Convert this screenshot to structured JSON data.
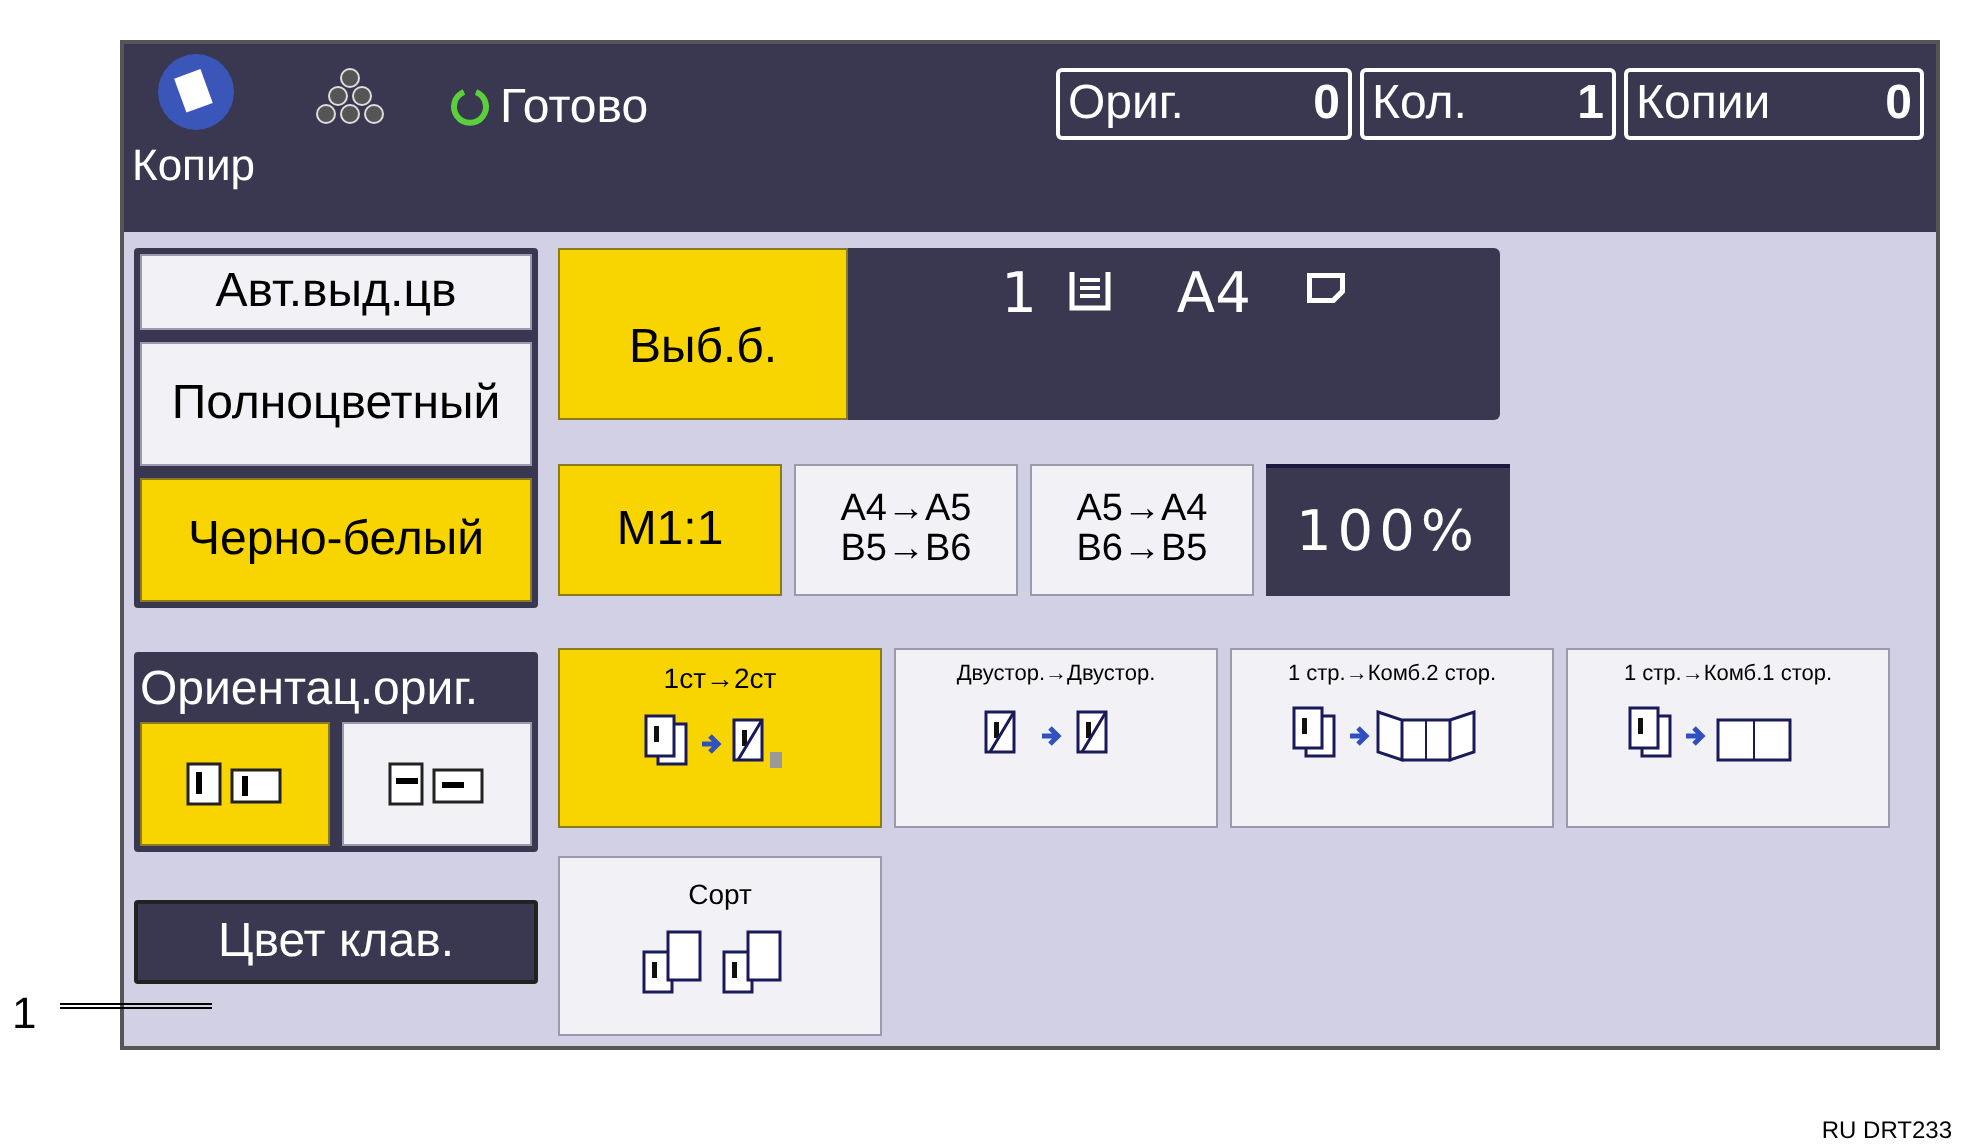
{
  "header": {
    "app_label": "Копир",
    "status": "Готово",
    "counters": [
      {
        "label": "Ориг.",
        "value": "0"
      },
      {
        "label": "Кол.",
        "value": "1"
      },
      {
        "label": "Копии",
        "value": "0"
      }
    ]
  },
  "color_modes": [
    {
      "label": "Авт.выд.цв",
      "selected": false
    },
    {
      "label": "Полноцветный",
      "selected": false
    },
    {
      "label": "Черно-белый",
      "selected": true
    }
  ],
  "orientation": {
    "title": "Ориентац.ориг.",
    "options": [
      {
        "kind": "upright",
        "selected": true
      },
      {
        "kind": "rotated",
        "selected": false
      }
    ]
  },
  "color_key_button": "Цвет клав.",
  "paper": {
    "button": {
      "label": "Выб.б.",
      "selected": true
    },
    "tray": "1",
    "size": "A4"
  },
  "ratio_buttons": [
    {
      "lines": [
        "M1:1"
      ],
      "selected": true
    },
    {
      "lines": [
        "A4→A5",
        "B5→B6"
      ],
      "selected": false
    },
    {
      "lines": [
        "A5→A4",
        "B6→B5"
      ],
      "selected": false
    }
  ],
  "ratio_value": "100%",
  "duplex_buttons": [
    {
      "label": "1ст→2ст",
      "kind": "one-to-two",
      "selected": true
    },
    {
      "label": "Двустор.→Двустор.",
      "kind": "two-to-two",
      "selected": false
    },
    {
      "label": "1 стр.→Комб.2 стор.",
      "kind": "combine-two",
      "selected": false
    },
    {
      "label": "1 стр.→Комб.1 стор.",
      "kind": "combine-one",
      "selected": false
    }
  ],
  "sort_button": {
    "label": "Сорт",
    "selected": false
  },
  "callout": "1",
  "figure_code": "RU DRT233"
}
